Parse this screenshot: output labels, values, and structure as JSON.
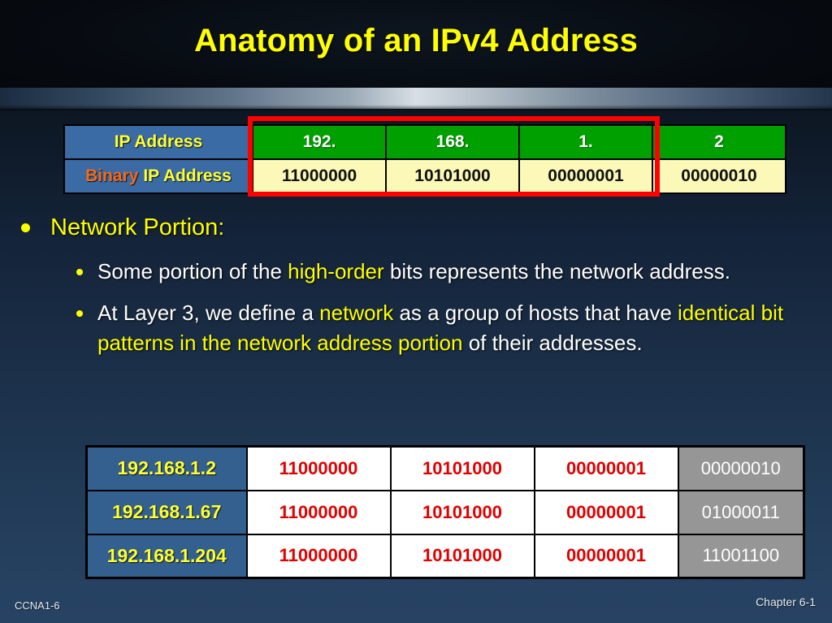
{
  "slide": {
    "title": "Anatomy of an IPv4 Address",
    "title_color": "#ffff00",
    "background_top_color": "#080d14",
    "background_bottom_color": "#274363"
  },
  "top_table": {
    "rows": [
      {
        "label_parts": [
          {
            "text": "IP Address",
            "color": "#ffff33"
          }
        ],
        "label_full": "IP Address",
        "cells": [
          "192.",
          "168.",
          "1.",
          "2"
        ],
        "cell_background": "#00a000",
        "cell_text_color": "#ffffff"
      },
      {
        "label_parts": [
          {
            "text": "Binary ",
            "color": "#f26a1b"
          },
          {
            "text": "IP Address",
            "color": "#ffff33"
          }
        ],
        "label_full": "Binary IP Address",
        "cells": [
          "11000000",
          "10101000",
          "00000001",
          "00000010"
        ],
        "cell_background": "#fbf8b8",
        "cell_text_color": "#111111"
      }
    ],
    "label_background": "#3a6ba5",
    "highlight_box": {
      "color": "#ff0000",
      "covers_columns": [
        "192.",
        "168.",
        "1."
      ],
      "meaning": "network portion"
    }
  },
  "bullets": {
    "level1": {
      "text": "Network Portion:",
      "color": "#ffff00"
    },
    "level2": [
      {
        "segments": [
          {
            "text": "Some portion of the ",
            "highlight": false
          },
          {
            "text": "high-order",
            "highlight": true
          },
          {
            "text": " bits represents the network address.",
            "highlight": false
          }
        ],
        "plain": "Some portion of the high-order bits represents the network address."
      },
      {
        "segments": [
          {
            "text": "At Layer 3, we define a ",
            "highlight": false
          },
          {
            "text": "network",
            "highlight": true
          },
          {
            "text": " as a group of hosts that have ",
            "highlight": false
          },
          {
            "text": "identical bit patterns in the network address portion",
            "highlight": true
          },
          {
            "text": " of their addresses.",
            "highlight": false
          }
        ],
        "plain": "At Layer 3, we define a network as a group of hosts that have identical bit patterns in the network address portion of their addresses."
      }
    ],
    "highlight_color": "#ffff00",
    "body_color": "#ffffff"
  },
  "bottom_table": {
    "network_text_color": "#e00000",
    "network_cell_background": "#ffffff",
    "host_cell_background": "#969696",
    "host_text_color": "#ffffff",
    "ip_cell_background": "#33608f",
    "ip_text_color": "#ffff33",
    "rows": [
      {
        "ip": "192.168.1.2",
        "octets": [
          "11000000",
          "10101000",
          "00000001",
          "00000010"
        ]
      },
      {
        "ip": "192.168.1.67",
        "octets": [
          "11000000",
          "10101000",
          "00000001",
          "01000011"
        ]
      },
      {
        "ip": "192.168.1.204",
        "octets": [
          "11000000",
          "10101000",
          "00000001",
          "11001100"
        ]
      }
    ]
  },
  "footer": {
    "left": "CCNA1-6",
    "right": "Chapter 6-1"
  }
}
